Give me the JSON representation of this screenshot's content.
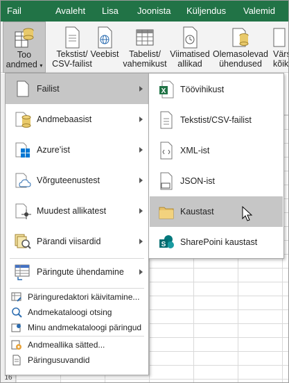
{
  "tabs": [
    "Fail",
    "Avaleht",
    "Lisa",
    "Joonista",
    "Küljendus",
    "Valemid"
  ],
  "ribbon": {
    "buttons": [
      {
        "line1": "Too",
        "line2": "andmed",
        "selected": true
      },
      {
        "line1": "Tekstist/",
        "line2": "CSV-failist"
      },
      {
        "line1": "Veebist",
        "line2": ""
      },
      {
        "line1": "Tabelist/",
        "line2": "vahemikust"
      },
      {
        "line1": "Viimatised",
        "line2": "allikad"
      },
      {
        "line1": "Olemasolevad",
        "line2": "ühendused"
      },
      {
        "line1": "Värsk",
        "line2": "kõik"
      }
    ]
  },
  "row_numbers": [
    "16"
  ],
  "menu": {
    "items": [
      {
        "label": "Failist",
        "icon": "file-icon",
        "submenu": true,
        "selected": true
      },
      {
        "label": "Andmebaasist",
        "icon": "database-icon",
        "submenu": true
      },
      {
        "label": "Azure’ist",
        "icon": "azure-icon",
        "submenu": true
      },
      {
        "label": "Võrguteenustest",
        "icon": "cloud-icon",
        "submenu": true
      },
      {
        "label": "Muudest allikatest",
        "icon": "other-sources-icon",
        "submenu": true
      },
      {
        "label": "Pärandi viisardid",
        "icon": "legacy-wizard-icon",
        "submenu": true
      },
      {
        "label": "Päringute ühendamine",
        "icon": "combine-queries-icon",
        "submenu": true
      }
    ],
    "small_items": [
      {
        "label": "Päringuredaktori käivitamine...",
        "icon": "query-editor-icon"
      },
      {
        "label": "Andmekataloogi otsing",
        "icon": "catalog-search-icon"
      },
      {
        "label": "Minu andmekataloogi päringud",
        "icon": "my-catalog-icon"
      },
      {
        "label": "Andmeallika sätted...",
        "icon": "data-source-settings-icon"
      },
      {
        "label": "Päringusuvandid",
        "icon": "query-options-icon"
      }
    ]
  },
  "submenu": {
    "items": [
      {
        "label": "Töövihikust",
        "icon": "excel-workbook-icon"
      },
      {
        "label": "Tekstist/CSV-failist",
        "icon": "text-file-icon"
      },
      {
        "label": "XML-ist",
        "icon": "xml-file-icon"
      },
      {
        "label": "JSON-ist",
        "icon": "json-file-icon"
      },
      {
        "label": "Kaustast",
        "icon": "folder-icon",
        "selected": true
      },
      {
        "label": "SharePoini kaustast",
        "icon": "sharepoint-icon"
      }
    ]
  },
  "colors": {
    "accent": "#217346",
    "selected_bg": "#c6c6c6",
    "ribbon_bg": "#f3f3f3"
  }
}
